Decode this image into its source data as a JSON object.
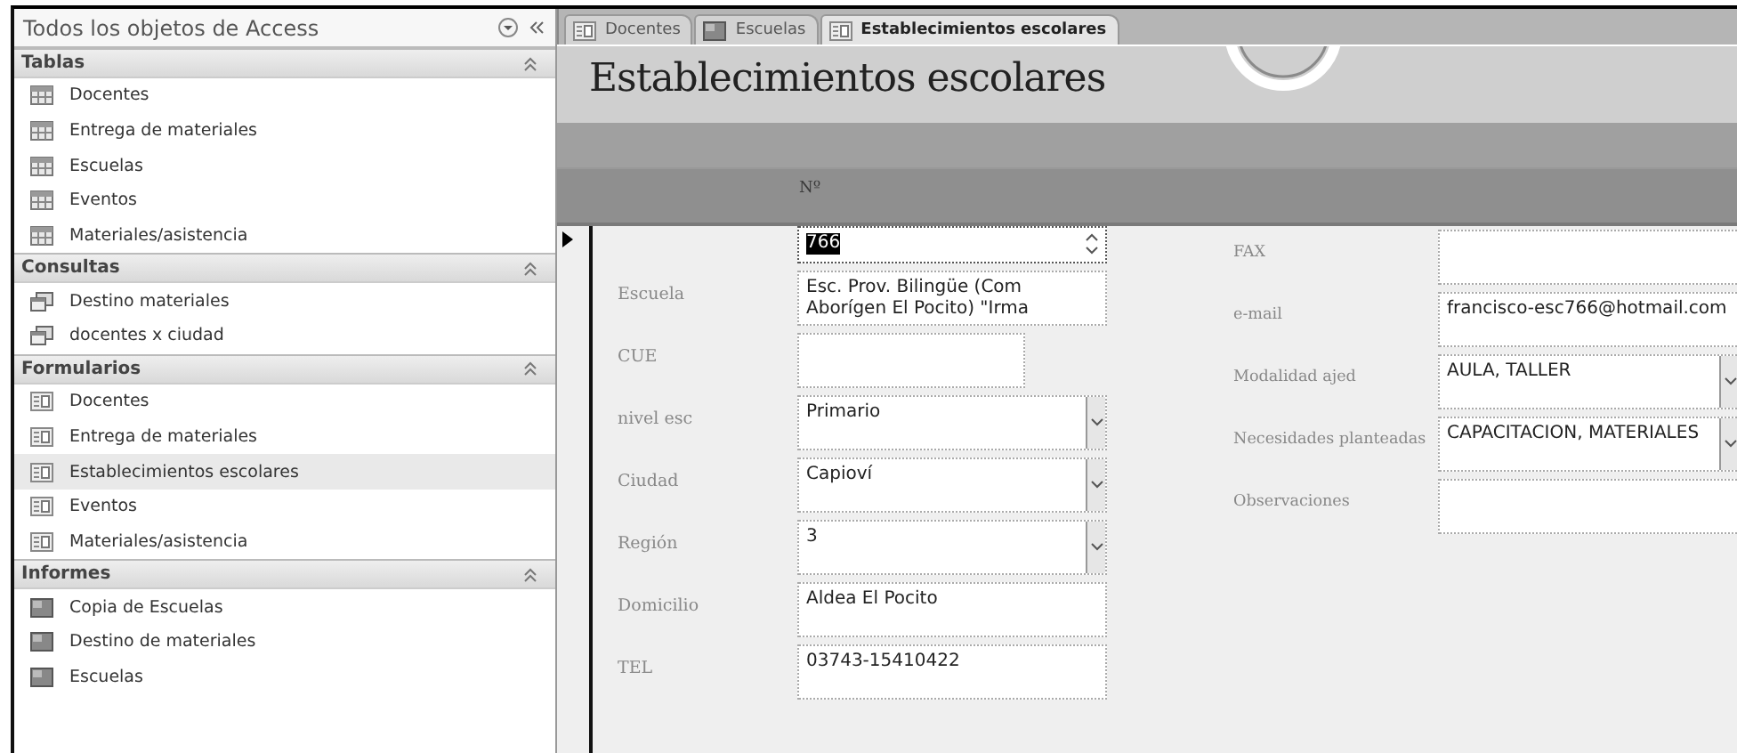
{
  "nav_pane": {
    "title": "Todos los objetos de Access",
    "groups": [
      {
        "label": "Tablas",
        "kind": "table",
        "expanded": true,
        "items": [
          {
            "label": "Docentes",
            "selected": false
          },
          {
            "label": "Entrega de materiales",
            "selected": false
          },
          {
            "label": "Escuelas",
            "selected": false
          },
          {
            "label": "Eventos",
            "selected": false
          },
          {
            "label": "Materiales/asistencia",
            "selected": false
          }
        ]
      },
      {
        "label": "Consultas",
        "kind": "query",
        "expanded": true,
        "items": [
          {
            "label": "Destino materiales",
            "selected": false
          },
          {
            "label": "docentes x ciudad",
            "selected": false
          }
        ]
      },
      {
        "label": "Formularios",
        "kind": "form",
        "expanded": true,
        "items": [
          {
            "label": "Docentes",
            "selected": false
          },
          {
            "label": "Entrega de materiales",
            "selected": false
          },
          {
            "label": "Establecimientos escolares",
            "selected": true
          },
          {
            "label": "Eventos",
            "selected": false
          },
          {
            "label": "Materiales/asistencia",
            "selected": false
          }
        ]
      },
      {
        "label": "Informes",
        "kind": "report",
        "expanded": true,
        "items": [
          {
            "label": "Copia de Escuelas",
            "selected": false
          },
          {
            "label": "Destino de materiales",
            "selected": false
          },
          {
            "label": "Escuelas",
            "selected": false
          }
        ]
      }
    ]
  },
  "tabs": [
    {
      "label": "Docentes",
      "kind": "form",
      "selected": false
    },
    {
      "label": "Escuelas",
      "kind": "report",
      "selected": false
    },
    {
      "label": "Establecimientos escolares",
      "kind": "form",
      "selected": true
    }
  ],
  "form": {
    "title": "Establecimientos escolares",
    "header_label": "Nº",
    "left_fields": [
      {
        "kind": "spinner",
        "value": "766",
        "highlighted": true
      },
      {
        "label": "Escuela",
        "kind": "text",
        "value": "Esc. Prov. Bilingüe (Com Aborígen El Pocito) \"Irma",
        "highlighted": false
      },
      {
        "label": "CUE",
        "kind": "short",
        "highlighted": false
      },
      {
        "label": "nivel esc",
        "kind": "combo",
        "value": "Primario",
        "highlighted": false
      },
      {
        "label": "Ciudad",
        "kind": "combo",
        "value": "Capioví",
        "highlighted": false
      },
      {
        "label": "Región",
        "kind": "combo",
        "value": "3",
        "highlighted": false
      },
      {
        "label": "Domicilio",
        "kind": "text",
        "value": "Aldea El Pocito",
        "highlighted": false
      },
      {
        "label": "TEL",
        "kind": "text",
        "value": "03743-15410422",
        "highlighted": false
      }
    ],
    "right_fields": [
      {
        "label": "FAX",
        "kind": "text",
        "highlighted": false
      },
      {
        "label": "e-mail",
        "kind": "text",
        "value": "francisco-esc766@hotmail.com",
        "highlighted": false
      },
      {
        "label": "Modalidad ajed",
        "kind": "combo",
        "value": "AULA, TALLER",
        "highlighted": false
      },
      {
        "label": "Necesidades planteadas",
        "kind": "combo",
        "value": "CAPACITACION, MATERIALES",
        "highlighted": false
      },
      {
        "label": "Observaciones",
        "kind": "text",
        "highlighted": false
      }
    ]
  }
}
